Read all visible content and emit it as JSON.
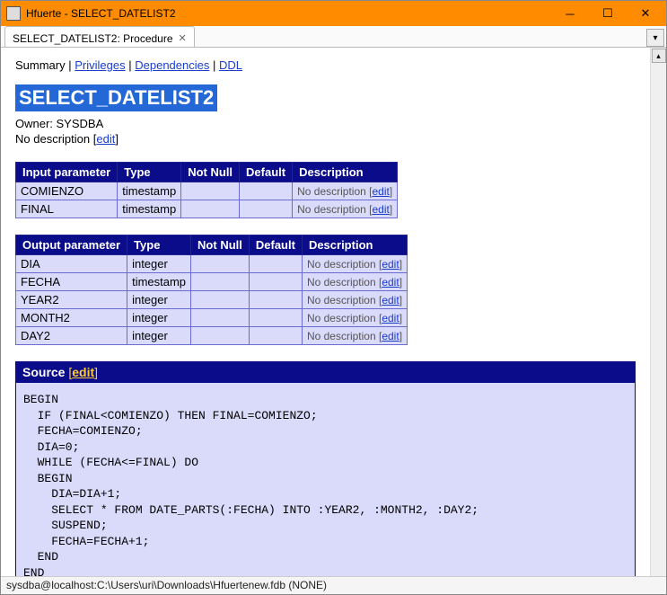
{
  "window": {
    "title": "Hfuerte - SELECT_DATELIST2"
  },
  "tab": {
    "label": "SELECT_DATELIST2: Procedure"
  },
  "subnav": {
    "summary": "Summary",
    "privileges": "Privileges",
    "dependencies": "Dependencies",
    "ddl": "DDL"
  },
  "object": {
    "name": "SELECT_DATELIST2",
    "owner_label": "Owner: SYSDBA",
    "no_description": "No description",
    "edit": "edit"
  },
  "input_table": {
    "headers": {
      "param": "Input parameter",
      "type": "Type",
      "notnull": "Not Null",
      "default": "Default",
      "desc": "Description"
    },
    "rows": [
      {
        "name": "COMIENZO",
        "type": "timestamp",
        "notnull": "",
        "default": "",
        "desc": "No description",
        "edit": "edit"
      },
      {
        "name": "FINAL",
        "type": "timestamp",
        "notnull": "",
        "default": "",
        "desc": "No description",
        "edit": "edit"
      }
    ]
  },
  "output_table": {
    "headers": {
      "param": "Output parameter",
      "type": "Type",
      "notnull": "Not Null",
      "default": "Default",
      "desc": "Description"
    },
    "rows": [
      {
        "name": "DIA",
        "type": "integer",
        "notnull": "",
        "default": "",
        "desc": "No description",
        "edit": "edit"
      },
      {
        "name": "FECHA",
        "type": "timestamp",
        "notnull": "",
        "default": "",
        "desc": "No description",
        "edit": "edit"
      },
      {
        "name": "YEAR2",
        "type": "integer",
        "notnull": "",
        "default": "",
        "desc": "No description",
        "edit": "edit"
      },
      {
        "name": "MONTH2",
        "type": "integer",
        "notnull": "",
        "default": "",
        "desc": "No description",
        "edit": "edit"
      },
      {
        "name": "DAY2",
        "type": "integer",
        "notnull": "",
        "default": "",
        "desc": "No description",
        "edit": "edit"
      }
    ]
  },
  "source": {
    "label": "Source",
    "edit": "edit",
    "code": "BEGIN\n  IF (FINAL<COMIENZO) THEN FINAL=COMIENZO;\n  FECHA=COMIENZO;\n  DIA=0;\n  WHILE (FECHA<=FINAL) DO\n  BEGIN\n    DIA=DIA+1;\n    SELECT * FROM DATE_PARTS(:FECHA) INTO :YEAR2, :MONTH2, :DAY2;\n    SUSPEND;\n    FECHA=FECHA+1;\n  END\nEND"
  },
  "statusbar": {
    "text": "sysdba@localhost:C:\\Users\\uri\\Downloads\\Hfuertenew.fdb (NONE)"
  }
}
